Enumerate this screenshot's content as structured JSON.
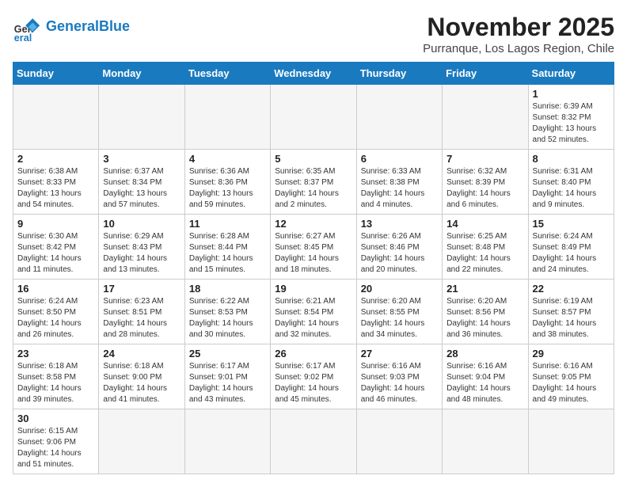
{
  "logo": {
    "general": "General",
    "blue": "Blue"
  },
  "header": {
    "month": "November 2025",
    "location": "Purranque, Los Lagos Region, Chile"
  },
  "weekdays": [
    "Sunday",
    "Monday",
    "Tuesday",
    "Wednesday",
    "Thursday",
    "Friday",
    "Saturday"
  ],
  "days": {
    "d1": {
      "num": "1",
      "info": "Sunrise: 6:39 AM\nSunset: 8:32 PM\nDaylight: 13 hours\nand 52 minutes."
    },
    "d2": {
      "num": "2",
      "info": "Sunrise: 6:38 AM\nSunset: 8:33 PM\nDaylight: 13 hours\nand 54 minutes."
    },
    "d3": {
      "num": "3",
      "info": "Sunrise: 6:37 AM\nSunset: 8:34 PM\nDaylight: 13 hours\nand 57 minutes."
    },
    "d4": {
      "num": "4",
      "info": "Sunrise: 6:36 AM\nSunset: 8:36 PM\nDaylight: 13 hours\nand 59 minutes."
    },
    "d5": {
      "num": "5",
      "info": "Sunrise: 6:35 AM\nSunset: 8:37 PM\nDaylight: 14 hours\nand 2 minutes."
    },
    "d6": {
      "num": "6",
      "info": "Sunrise: 6:33 AM\nSunset: 8:38 PM\nDaylight: 14 hours\nand 4 minutes."
    },
    "d7": {
      "num": "7",
      "info": "Sunrise: 6:32 AM\nSunset: 8:39 PM\nDaylight: 14 hours\nand 6 minutes."
    },
    "d8": {
      "num": "8",
      "info": "Sunrise: 6:31 AM\nSunset: 8:40 PM\nDaylight: 14 hours\nand 9 minutes."
    },
    "d9": {
      "num": "9",
      "info": "Sunrise: 6:30 AM\nSunset: 8:42 PM\nDaylight: 14 hours\nand 11 minutes."
    },
    "d10": {
      "num": "10",
      "info": "Sunrise: 6:29 AM\nSunset: 8:43 PM\nDaylight: 14 hours\nand 13 minutes."
    },
    "d11": {
      "num": "11",
      "info": "Sunrise: 6:28 AM\nSunset: 8:44 PM\nDaylight: 14 hours\nand 15 minutes."
    },
    "d12": {
      "num": "12",
      "info": "Sunrise: 6:27 AM\nSunset: 8:45 PM\nDaylight: 14 hours\nand 18 minutes."
    },
    "d13": {
      "num": "13",
      "info": "Sunrise: 6:26 AM\nSunset: 8:46 PM\nDaylight: 14 hours\nand 20 minutes."
    },
    "d14": {
      "num": "14",
      "info": "Sunrise: 6:25 AM\nSunset: 8:48 PM\nDaylight: 14 hours\nand 22 minutes."
    },
    "d15": {
      "num": "15",
      "info": "Sunrise: 6:24 AM\nSunset: 8:49 PM\nDaylight: 14 hours\nand 24 minutes."
    },
    "d16": {
      "num": "16",
      "info": "Sunrise: 6:24 AM\nSunset: 8:50 PM\nDaylight: 14 hours\nand 26 minutes."
    },
    "d17": {
      "num": "17",
      "info": "Sunrise: 6:23 AM\nSunset: 8:51 PM\nDaylight: 14 hours\nand 28 minutes."
    },
    "d18": {
      "num": "18",
      "info": "Sunrise: 6:22 AM\nSunset: 8:53 PM\nDaylight: 14 hours\nand 30 minutes."
    },
    "d19": {
      "num": "19",
      "info": "Sunrise: 6:21 AM\nSunset: 8:54 PM\nDaylight: 14 hours\nand 32 minutes."
    },
    "d20": {
      "num": "20",
      "info": "Sunrise: 6:20 AM\nSunset: 8:55 PM\nDaylight: 14 hours\nand 34 minutes."
    },
    "d21": {
      "num": "21",
      "info": "Sunrise: 6:20 AM\nSunset: 8:56 PM\nDaylight: 14 hours\nand 36 minutes."
    },
    "d22": {
      "num": "22",
      "info": "Sunrise: 6:19 AM\nSunset: 8:57 PM\nDaylight: 14 hours\nand 38 minutes."
    },
    "d23": {
      "num": "23",
      "info": "Sunrise: 6:18 AM\nSunset: 8:58 PM\nDaylight: 14 hours\nand 39 minutes."
    },
    "d24": {
      "num": "24",
      "info": "Sunrise: 6:18 AM\nSunset: 9:00 PM\nDaylight: 14 hours\nand 41 minutes."
    },
    "d25": {
      "num": "25",
      "info": "Sunrise: 6:17 AM\nSunset: 9:01 PM\nDaylight: 14 hours\nand 43 minutes."
    },
    "d26": {
      "num": "26",
      "info": "Sunrise: 6:17 AM\nSunset: 9:02 PM\nDaylight: 14 hours\nand 45 minutes."
    },
    "d27": {
      "num": "27",
      "info": "Sunrise: 6:16 AM\nSunset: 9:03 PM\nDaylight: 14 hours\nand 46 minutes."
    },
    "d28": {
      "num": "28",
      "info": "Sunrise: 6:16 AM\nSunset: 9:04 PM\nDaylight: 14 hours\nand 48 minutes."
    },
    "d29": {
      "num": "29",
      "info": "Sunrise: 6:16 AM\nSunset: 9:05 PM\nDaylight: 14 hours\nand 49 minutes."
    },
    "d30": {
      "num": "30",
      "info": "Sunrise: 6:15 AM\nSunset: 9:06 PM\nDaylight: 14 hours\nand 51 minutes."
    }
  }
}
